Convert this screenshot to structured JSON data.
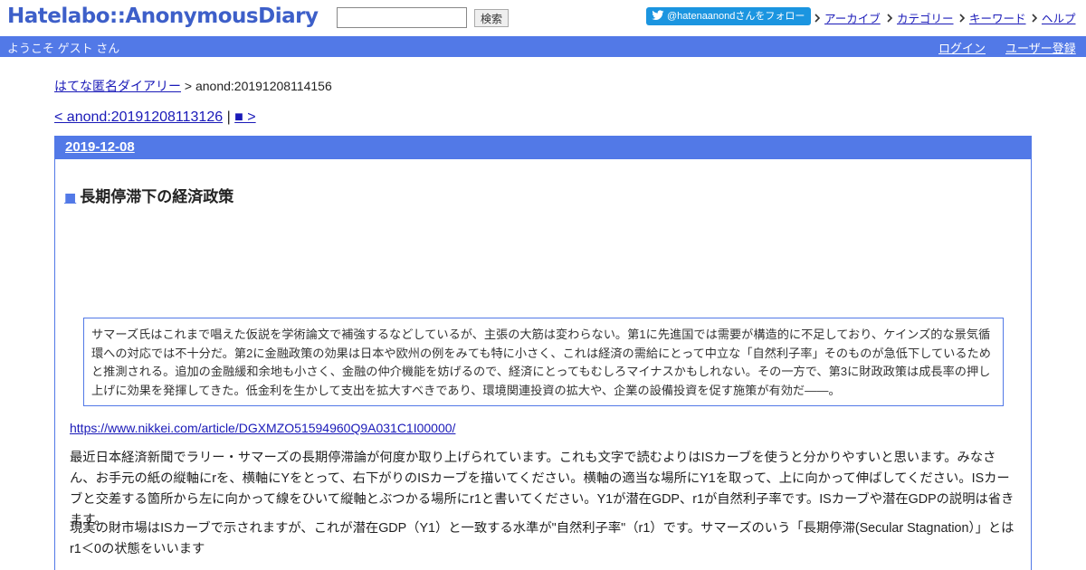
{
  "header": {
    "logo": "Hatelabo::AnonymousDiary",
    "search_placeholder": "",
    "search_button": "検索",
    "follow_label": "@hatenaanondさんをフォロー",
    "nav": [
      "アーカイブ",
      "カテゴリー",
      "キーワード",
      "ヘルプ"
    ]
  },
  "userbar": {
    "welcome": "ようこそ ゲスト さん",
    "login": "ログイン",
    "register": "ユーザー登録"
  },
  "breadcrumb": {
    "home": "はてな匿名ダイアリー",
    "separator": " > ",
    "current": "anond:20191208114156"
  },
  "pager": {
    "prev": "< anond:20191208113126",
    "separator": " | ",
    "next": "■ >"
  },
  "entry": {
    "date": "2019-12-08",
    "title_marker": "■",
    "title": "長期停滞下の経済政策",
    "quote": "サマーズ氏はこれまで唱えた仮説を学術論文で補強するなどしているが、主張の大筋は変わらない。第1に先進国では需要が構造的に不足しており、ケインズ的な景気循環への対応では不十分だ。第2に金融政策の効果は日本や欧州の例をみても特に小さく、これは経済の需給にとって中立な「自然利子率」そのものが急低下しているためと推測される。追加の金融緩和余地も小さく、金融の仲介機能を妨げるので、経済にとってもむしろマイナスかもしれない。その一方で、第3に財政政策は成長率の押し上げに効果を発揮してきた。低金利を生かして支出を拡大すべきであり、環境関連投資の拡大や、企業の設備投資を促す施策が有効だ――。",
    "source_link": "https://www.nikkei.com/article/DGXMZO51594960Q9A031C1I00000/",
    "para1": "最近日本経済新聞でラリー・サマーズの長期停滞論が何度か取り上げられています。これも文字で読むよりはISカーブを使うと分かりやすいと思います。みなさん、お手元の紙の縦軸にrを、横軸にYをとって、右下がりのISカーブを描いてください。横軸の適当な場所にY1を取って、上に向かって伸ばしてください。ISカーブと交差する箇所から左に向かって線をひいて縦軸とぶつかる場所にr1と書いてください。Y1が潜在GDP、r1が自然利子率です。ISカーブや潜在GDPの説明は省きます。",
    "para2": "現実の財市場はISカーブで示されますが、これが潜在GDP（Y1）と一致する水準が\"自然利子率\"（r1）です。サマーズのいう「長期停滞(Secular Stagnation）」とはr1＜0の状態をいいます"
  },
  "colors": {
    "accent": "#5279e7",
    "logo": "#3d5fc9",
    "twitter": "#1b95e0",
    "link": "#1a1ab8"
  }
}
